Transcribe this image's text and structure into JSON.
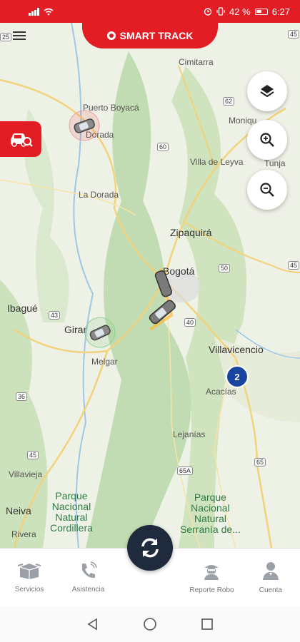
{
  "status_bar": {
    "battery": "42 %",
    "time": "6:27"
  },
  "app": {
    "title": "SMART TRACK"
  },
  "map": {
    "labels": {
      "cimitarra": "Cimitarra",
      "puerto_boyaca": "Puerto Boyacá",
      "la_dorada": "La Dorada",
      "dorada": "Dorada",
      "moniquira": "Moniqu",
      "villa_de_leyva": "Villa de Leyva",
      "tunja": "Tunja",
      "zipaquira": "Zipaquirá",
      "bogota": "Bogotá",
      "ibague": "Ibagué",
      "girardot": "Girar",
      "melgar": "Melgar",
      "villavicencio": "Villavicencio",
      "acacias": "Acacías",
      "lejanias": "Lejanías",
      "villavieja": "Villavieja",
      "neiva": "Neiva",
      "rivera": "Rivera",
      "park1": "Parque\nNacional\nNatural\nCordillera",
      "park2": "Parque\nNacional\nNatural\nSerranía de..."
    },
    "shields": {
      "r25": "25",
      "r62": "62",
      "r60": "60",
      "r45a": "45",
      "r50": "50",
      "r43": "43",
      "r40": "40",
      "r36": "36",
      "r45b": "45",
      "r65a": "65A",
      "r65": "65",
      "r45c": "45"
    },
    "cluster_count": "2"
  },
  "controls": {
    "layers_icon": "layers-icon",
    "zoom_in_icon": "zoom-in-icon",
    "zoom_out_icon": "zoom-out-icon",
    "vehicle_search_icon": "car-search-icon"
  },
  "bottom_nav": {
    "servicios": "Servicios",
    "asistencia": "Asistencia",
    "reporte_robo": "Reporte Robo",
    "cuenta": "Cuenta"
  },
  "colors": {
    "brand_red": "#e31d24",
    "refresh_bg": "#1f2a3c",
    "cluster_blue": "#1745a0"
  }
}
